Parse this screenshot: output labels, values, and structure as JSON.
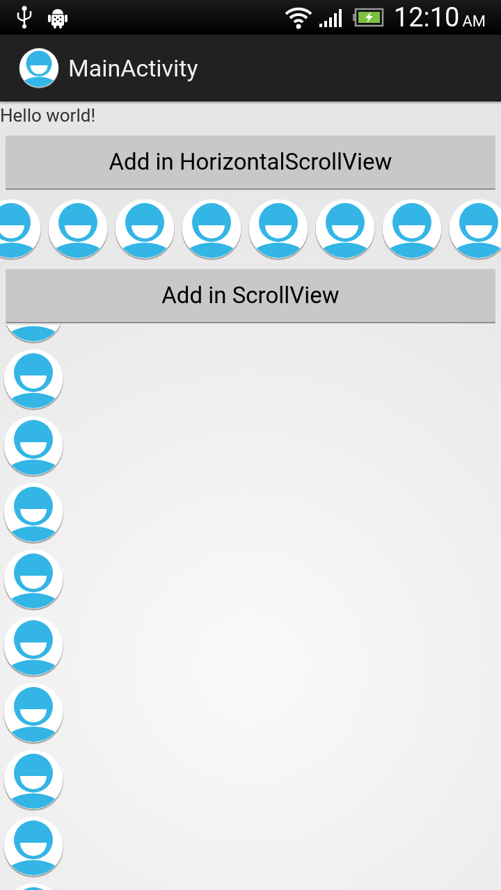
{
  "status_bar": {
    "time": "12:10",
    "period": "AM"
  },
  "action_bar": {
    "title": "MainActivity"
  },
  "greeting": "Hello world!",
  "buttons": [
    {
      "label": "Add in HorizontalScrollView"
    },
    {
      "label": "Add in ScrollView"
    }
  ]
}
